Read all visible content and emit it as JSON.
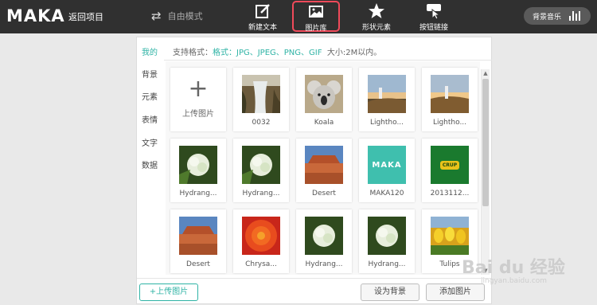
{
  "topbar": {
    "logo": "MAKA",
    "back_label": "返回项目",
    "mode_label": "自由模式",
    "tools": [
      {
        "label": "新建文本",
        "icon": "edit-icon"
      },
      {
        "label": "图片库",
        "icon": "image-icon"
      },
      {
        "label": "形状元素",
        "icon": "star-icon"
      },
      {
        "label": "按钮链接",
        "icon": "button-link-icon"
      }
    ],
    "music_label": "背景音乐"
  },
  "nav": {
    "items": [
      "我的",
      "背景",
      "元素",
      "表情",
      "文字",
      "数据"
    ]
  },
  "hint": {
    "prefix": "支持格式：",
    "formats": "格式：JPG、JPEG、PNG、GIF",
    "size": "大小:2M以内。"
  },
  "gallery": {
    "upload_label": "上传图片",
    "items": [
      {
        "caption": "0032"
      },
      {
        "caption": "Koala"
      },
      {
        "caption": "Lightho..."
      },
      {
        "caption": "Lightho..."
      },
      {
        "caption": "Hydrang..."
      },
      {
        "caption": "Hydrang..."
      },
      {
        "caption": "Desert"
      },
      {
        "caption": "MAKA120",
        "thumb_text": "MAKA"
      },
      {
        "caption": "2013112...",
        "thumb_text": "CRUP"
      },
      {
        "caption": "Desert"
      },
      {
        "caption": "Chrysa..."
      },
      {
        "caption": "Hydrang..."
      },
      {
        "caption": "Hydrang..."
      },
      {
        "caption": "Tulips"
      }
    ]
  },
  "footer": {
    "upload_button": "+上传图片",
    "set_background_button": "设为背景",
    "add_image_button": "添加图片"
  },
  "watermark": {
    "text": "Bai du 经验",
    "sub": "jingyan.baidu.com"
  },
  "colors": {
    "accent": "#2fb3a5",
    "topbar": "#303030",
    "active_border": "#f04a5a"
  }
}
